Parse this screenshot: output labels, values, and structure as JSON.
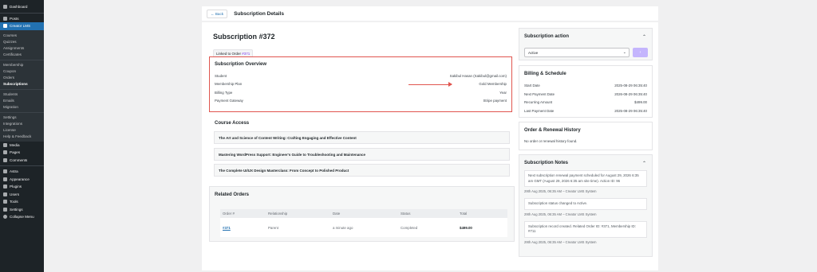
{
  "sidebar": {
    "items": [
      {
        "label": "Dashboard",
        "icon": "dashboard-icon"
      },
      {
        "label": "Posts",
        "icon": "pin-icon"
      },
      {
        "label": "Creator LMS",
        "icon": "graduation-cap-icon",
        "active": true
      }
    ],
    "submenu": [
      "Courses",
      "Quizzes",
      "Assignments",
      "Certificates"
    ],
    "submenu2": [
      "Membership",
      "Coupon",
      "Orders",
      "Subscriptions"
    ],
    "submenu3": [
      "Students",
      "Emails",
      "Migration"
    ],
    "submenu4": [
      "Settings",
      "Integrations",
      "License",
      "Help & Feedback"
    ],
    "items2": [
      {
        "label": "Media",
        "icon": "media-icon"
      },
      {
        "label": "Pages",
        "icon": "page-icon"
      },
      {
        "label": "Comments",
        "icon": "comment-icon"
      }
    ],
    "items3": [
      {
        "label": "Astra",
        "icon": "astra-icon"
      },
      {
        "label": "Appearance",
        "icon": "brush-icon"
      },
      {
        "label": "Plugins",
        "icon": "plugin-icon"
      },
      {
        "label": "Users",
        "icon": "users-icon"
      },
      {
        "label": "Tools",
        "icon": "wrench-icon"
      },
      {
        "label": "Settings",
        "icon": "settings-icon"
      },
      {
        "label": "Collapse Menu",
        "icon": "collapse-icon"
      }
    ]
  },
  "header": {
    "back_label": "← Back",
    "title": "Subscription Details"
  },
  "subscription": {
    "title": "Subscription #372",
    "linked_prefix": "Linked to Order ",
    "linked_order": "#371"
  },
  "overview": {
    "title": "Subscription Overview",
    "rows": [
      {
        "label": "Student",
        "value": "Sakibul Hasan (Sakibul@gmail.com)"
      },
      {
        "label": "Membership Plan",
        "value": "Gold Membership"
      },
      {
        "label": "Billing Type",
        "value": "Year"
      },
      {
        "label": "Payment Gateway",
        "value": "Stripe payment"
      }
    ]
  },
  "course_access": {
    "title": "Course Access",
    "courses": [
      "The Art and Science of Content Writing: Crafting Engaging and Effective Content",
      "Mastering WordPress Support: Engineer's Guide to Troubleshooting and Maintenance",
      "The Complete UI/UX Design Masterclass: From Concept to Polished Product"
    ]
  },
  "related_orders": {
    "title": "Related Orders",
    "headers": [
      "Order #",
      "Relationship",
      "Date",
      "Status",
      "Total"
    ],
    "rows": [
      [
        "#371",
        "Parent",
        "a minute ago",
        "Completed",
        "$499.00"
      ]
    ]
  },
  "action": {
    "title": "Subscription action",
    "selected": "Active",
    "apply_label": "›"
  },
  "billing": {
    "title": "Billing & Schedule",
    "rows": [
      {
        "label": "Start Date",
        "value": "2025-08-29 06:35:40"
      },
      {
        "label": "Next Payment Date",
        "value": "2026-08-29 06:35:40"
      },
      {
        "label": "Recurring Amount",
        "value": "$499.00"
      },
      {
        "label": "Last Payment Date",
        "value": "2025-08-29 06:35:40"
      }
    ]
  },
  "history": {
    "title": "Order & Renewal History",
    "empty": "No order or renewal history found."
  },
  "notes": {
    "title": "Subscription Notes",
    "items": [
      {
        "text": "Next subscription renewal payment scheduled for August 29, 2026 6:35 am GMT (August 29, 2026 6:35 am site time). Action ID: 96",
        "meta": "29th Aug 2025, 06:35 AM – Creator LMS System"
      },
      {
        "text": "Subscription status changed to Active.",
        "meta": "29th Aug 2025, 06:35 AM – Creator LMS System"
      },
      {
        "text": "Subscription record created. Related Order ID: #371, Membership ID: #711",
        "meta": "29th Aug 2025, 06:35 AM – Creator LMS System"
      }
    ]
  },
  "colors": {
    "accent": "#2271b1",
    "highlight": "#e0554f",
    "purple": "#7c3aed"
  }
}
